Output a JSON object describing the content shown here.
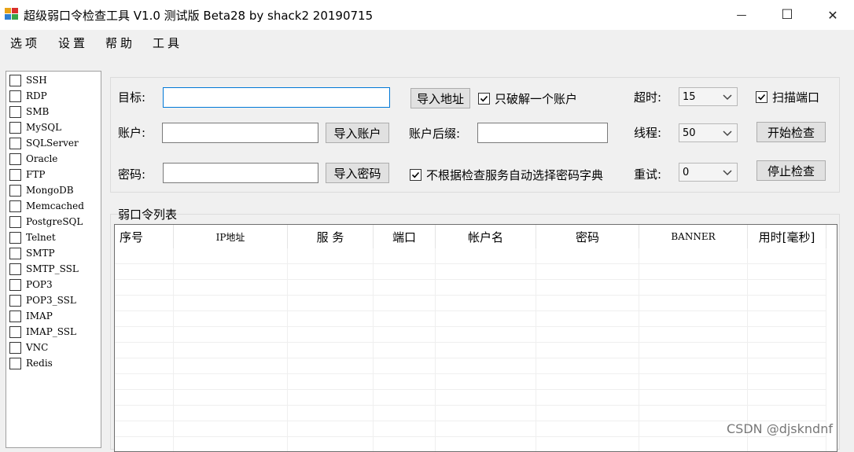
{
  "window": {
    "title": "超级弱口令检查工具 V1.0 测试版 Beta28 by shack2 20190715",
    "minimize_glyph": "—",
    "maximize_glyph": "☐",
    "close_glyph": "✕"
  },
  "menu": [
    "选项",
    "设置",
    "帮助",
    "工具"
  ],
  "services": [
    {
      "label": "SSH",
      "checked": false
    },
    {
      "label": "RDP",
      "checked": false
    },
    {
      "label": "SMB",
      "checked": false
    },
    {
      "label": "MySQL",
      "checked": false
    },
    {
      "label": "SQLServer",
      "checked": false
    },
    {
      "label": "Oracle",
      "checked": false
    },
    {
      "label": "FTP",
      "checked": false
    },
    {
      "label": "MongoDB",
      "checked": false
    },
    {
      "label": "Memcached",
      "checked": false
    },
    {
      "label": "PostgreSQL",
      "checked": false
    },
    {
      "label": "Telnet",
      "checked": false
    },
    {
      "label": "SMTP",
      "checked": false
    },
    {
      "label": "SMTP_SSL",
      "checked": false
    },
    {
      "label": "POP3",
      "checked": false
    },
    {
      "label": "POP3_SSL",
      "checked": false
    },
    {
      "label": "IMAP",
      "checked": false
    },
    {
      "label": "IMAP_SSL",
      "checked": false
    },
    {
      "label": "VNC",
      "checked": false
    },
    {
      "label": "Redis",
      "checked": false
    }
  ],
  "config": {
    "target_label": "目标:",
    "target_value": "",
    "import_address_button": "导入地址",
    "crack_one_account_label": "只破解一个账户",
    "crack_one_account_checked": true,
    "timeout_label": "超时:",
    "timeout_value": "15",
    "scan_port_label": "扫描端口",
    "scan_port_checked": true,
    "account_label": "账户:",
    "account_value": "",
    "import_account_button": "导入账户",
    "account_suffix_label": "账户后缀:",
    "account_suffix_value": "",
    "threads_label": "线程:",
    "threads_value": "50",
    "start_button": "开始检查",
    "password_label": "密码:",
    "password_value": "",
    "import_password_button": "导入密码",
    "auto_dict_label": "不根据检查服务自动选择密码字典",
    "auto_dict_checked": true,
    "retry_label": "重试:",
    "retry_value": "0",
    "stop_button": "停止检查"
  },
  "results": {
    "group_title": "弱口令列表",
    "columns": [
      "序号",
      "IP地址",
      "服 务",
      "端口",
      "帐户名",
      "密码",
      "BANNER",
      "用时[毫秒]"
    ],
    "rows": []
  },
  "watermark": "CSDN @djskndnf",
  "colors": {
    "focus_border": "#0078d7",
    "check_mark": "#000000"
  }
}
